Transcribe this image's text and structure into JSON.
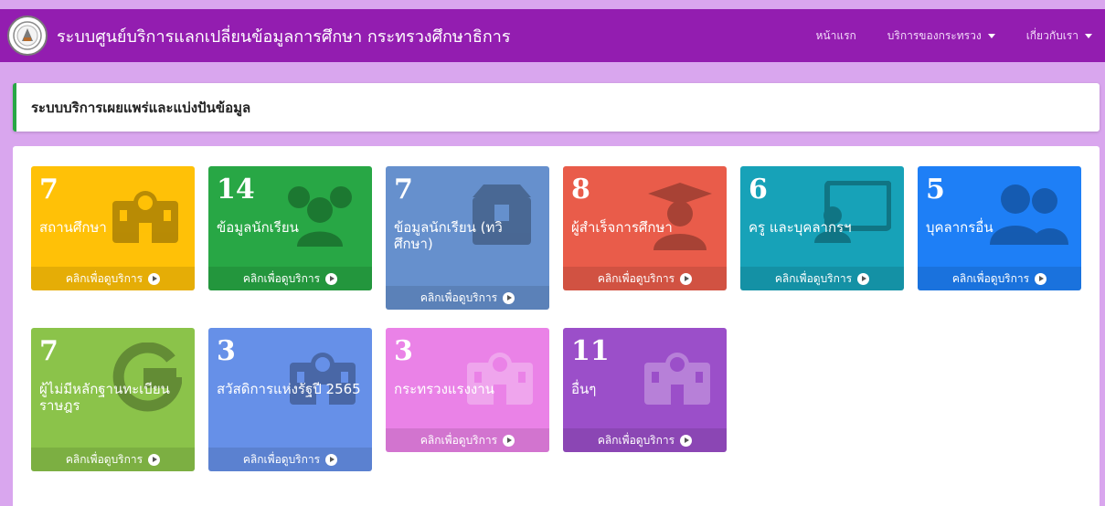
{
  "navbar": {
    "title": "ระบบศูนย์บริการแลกเปลี่ยนข้อมูลการศึกษา กระทรวงศึกษาธิการ",
    "links": [
      {
        "label": "หน้าแรก",
        "dropdown": false
      },
      {
        "label": "บริการของกระทรวง",
        "dropdown": true
      },
      {
        "label": "เกี่ยวกับเรา",
        "dropdown": true
      }
    ]
  },
  "page": {
    "title": "ระบบบริการเผยแพร่และแบ่งปันข้อมูล"
  },
  "boxes": [
    {
      "count": "7",
      "label": "สถานศึกษา",
      "footer": "คลิกเพื่อดูบริการ",
      "color": "#ffc107",
      "icon": "school-icon"
    },
    {
      "count": "14",
      "label": "ข้อมูลนักเรียน",
      "footer": "คลิกเพื่อดูบริการ",
      "color": "#28a745",
      "icon": "users-icon"
    },
    {
      "count": "7",
      "label": "ข้อมูลนักเรียน (ทวิศึกษา)",
      "footer": "คลิกเพื่อดูบริการ",
      "color": "#6690cd",
      "icon": "box-icon"
    },
    {
      "count": "8",
      "label": "ผู้สำเร็จการศึกษา",
      "footer": "คลิกเพื่อดูบริการ",
      "color": "#e95c4a",
      "icon": "graduate-icon"
    },
    {
      "count": "6",
      "label": "ครู และบุคลากรฯ",
      "footer": "คลิกเพื่อดูบริการ",
      "color": "#17a2b8",
      "icon": "teacher-icon"
    },
    {
      "count": "5",
      "label": "บุคลากรอื่น",
      "footer": "คลิกเพื่อดูบริการ",
      "color": "#1e7ff6",
      "icon": "user-group-icon"
    },
    {
      "count": "7",
      "label": "ผู้ไม่มีหลักฐานทะเบียนราษฎร",
      "footer": "คลิกเพื่อดูบริการ",
      "color": "#8bc34a",
      "icon": "g-icon"
    },
    {
      "count": "3",
      "label": "สวัสดิการแห่งรัฐปี 2565",
      "footer": "คลิกเพื่อดูบริการ",
      "color": "#6690e8",
      "icon": "school-icon"
    },
    {
      "count": "3",
      "label": "กระทรวงแรงงาน",
      "footer": "คลิกเพื่อดูบริการ",
      "color": "#ea82e7",
      "icon": "school-icon"
    },
    {
      "count": "11",
      "label": "อื่นๆ",
      "footer": "คลิกเพื่อดูบริการ",
      "color": "#9b4fc9",
      "icon": "school-icon"
    }
  ]
}
